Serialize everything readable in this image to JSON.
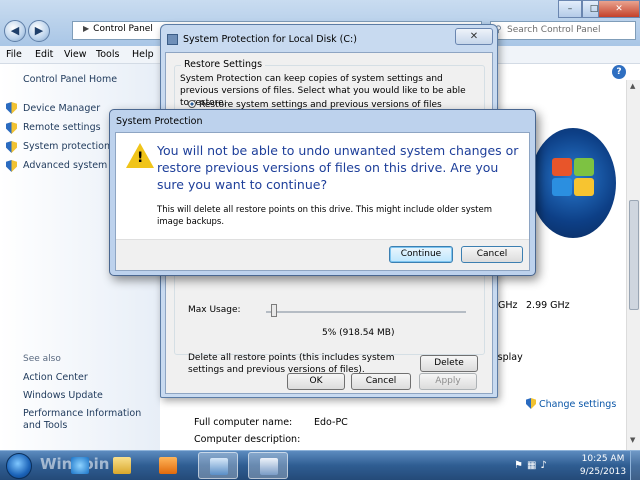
{
  "explorer": {
    "address": [
      "Control Panel"
    ],
    "search_placeholder": "Search Control Panel",
    "menu": [
      "File",
      "Edit",
      "View",
      "Tools",
      "Help"
    ],
    "window_controls": {
      "minimize": "–",
      "maximize": "□",
      "close": "✕"
    }
  },
  "left_pane": {
    "home": "Control Panel Home",
    "tasks": [
      "Device Manager",
      "Remote settings",
      "System protection",
      "Advanced system settings"
    ],
    "see_also_title": "See also",
    "see_also": [
      "Action Center",
      "Windows Update",
      "Performance Information and Tools"
    ]
  },
  "content": {
    "processor_speed": "0GHz",
    "processor_speed2": "2.99 GHz",
    "display_fragment": "isplay",
    "change_settings": "Change settings",
    "full_name_label": "Full computer name:",
    "full_name_value": "Edo-PC",
    "description_label": "Computer description:"
  },
  "system_protection": {
    "title": "System Protection for Local Disk (C:)",
    "close": "✕",
    "group_title": "Restore Settings",
    "description": "System Protection can keep copies of system settings and previous versions of files. Select what you would like to be able to restore:",
    "option_1": "Restore system settings and previous versions of files",
    "max_usage_label": "Max Usage:",
    "usage_value": "5% (918.54 MB)",
    "delete_text": "Delete all restore points (this includes system settings and previous versions of files).",
    "delete_button": "Delete",
    "ok": "OK",
    "cancel": "Cancel",
    "apply": "Apply"
  },
  "confirm": {
    "title": "System Protection",
    "main_instruction": "You will not be able to undo unwanted system changes or restore previous versions of files on this drive. Are you sure you want to continue?",
    "content": "This will delete all restore points on this drive. This might include older system image backups.",
    "continue_button": "Continue",
    "cancel_button": "Cancel"
  },
  "taskbar": {
    "watermark": "WinPoin",
    "time": "10:25 AM",
    "date": "9/25/2013"
  },
  "colors": {
    "instruction_text": "#1e3f9a",
    "link": "#0b57a8",
    "taskbar": "#2f5d92"
  }
}
